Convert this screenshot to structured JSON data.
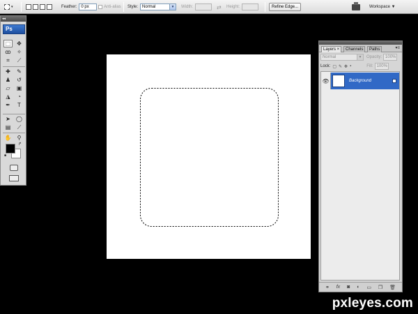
{
  "app": {
    "logo": "Ps",
    "toolbox_collapse": "◂◂"
  },
  "options_bar": {
    "feather_label": "Feather:",
    "feather_value": "0 px",
    "antialias_label": "Anti-alias",
    "style_label": "Style:",
    "style_value": "Normal",
    "width_label": "Width:",
    "height_label": "Height:",
    "swap_glyph": "⇄",
    "refine_edge_label": "Refine Edge...",
    "workspace_label": "Workspace ▼"
  },
  "toolbox": {
    "tools": [
      {
        "name": "marquee-tool-icon",
        "glyph": "⬚"
      },
      {
        "name": "move-tool-icon",
        "glyph": "✥"
      },
      {
        "name": "lasso-tool-icon",
        "glyph": "ꝏ"
      },
      {
        "name": "magic-wand-tool-icon",
        "glyph": "✧"
      },
      {
        "name": "crop-tool-icon",
        "glyph": "⌗"
      },
      {
        "name": "eyedropper-tool-icon",
        "glyph": "⟋"
      },
      {
        "name": "healing-brush-tool-icon",
        "glyph": "✚"
      },
      {
        "name": "brush-tool-icon",
        "glyph": "✎"
      },
      {
        "name": "clone-stamp-tool-icon",
        "glyph": "♟"
      },
      {
        "name": "history-brush-tool-icon",
        "glyph": "↺"
      },
      {
        "name": "eraser-tool-icon",
        "glyph": "▱"
      },
      {
        "name": "gradient-tool-icon",
        "glyph": "▣"
      },
      {
        "name": "blur-tool-icon",
        "glyph": "◮"
      },
      {
        "name": "dodge-tool-icon",
        "glyph": "◔"
      },
      {
        "name": "pen-tool-icon",
        "glyph": "✒"
      },
      {
        "name": "type-tool-icon",
        "glyph": "T"
      },
      {
        "name": "path-selection-tool-icon",
        "glyph": "➤"
      },
      {
        "name": "shape-tool-icon",
        "glyph": "◯"
      },
      {
        "name": "notes-tool-icon",
        "glyph": "▤"
      },
      {
        "name": "eyedropper2-tool-icon",
        "glyph": "⟋"
      },
      {
        "name": "hand-tool-icon",
        "glyph": "✋"
      },
      {
        "name": "zoom-tool-icon",
        "glyph": "⚲"
      }
    ],
    "foreground_color": "#000000",
    "background_color": "#ffffff"
  },
  "layers_panel": {
    "tabs": [
      "Layers ×",
      "Channels",
      "Paths"
    ],
    "blend_mode": "Normal",
    "opacity_label": "Opacity:",
    "opacity_value": "100%",
    "lock_label": "Lock:",
    "fill_label": "Fill:",
    "fill_value": "100%",
    "layers": [
      {
        "name": "Background",
        "visible": true,
        "locked": true,
        "selected": true
      }
    ],
    "footer_icons": [
      "link-icon",
      "fx-icon",
      "mask-icon",
      "adjustment-icon",
      "group-icon",
      "new-layer-icon",
      "trash-icon"
    ]
  },
  "watermark": "pxleyes.com",
  "colors": {
    "selection_highlight": "#3169c6",
    "app_background": "#000000"
  }
}
